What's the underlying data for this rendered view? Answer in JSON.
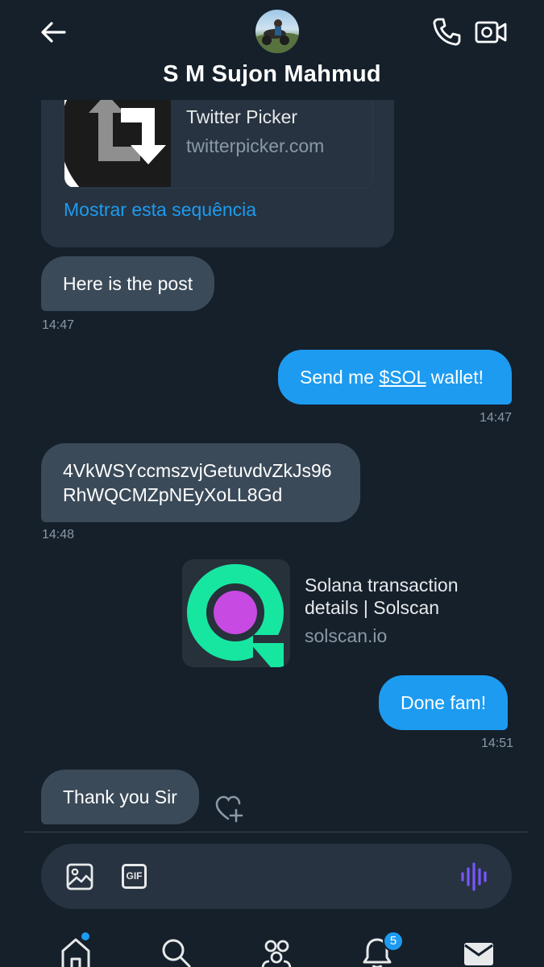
{
  "header": {
    "contact_name": "S M Sujon Mahmud",
    "back_icon": "arrow-left-icon",
    "call_icon": "phone-icon",
    "video_icon": "video-camera-icon"
  },
  "messages": [
    {
      "type": "link_card",
      "direction": "incoming",
      "card_title": "Twitter Picker",
      "card_domain": "twitterpicker.com",
      "action_link": "Mostrar esta sequência"
    },
    {
      "type": "text",
      "direction": "incoming",
      "text": "Here is the post",
      "time": "14:47"
    },
    {
      "type": "text",
      "direction": "outgoing",
      "text_before": "Send me ",
      "cashtag": "$SOL",
      "text_after": " wallet!",
      "time": "14:47"
    },
    {
      "type": "text",
      "direction": "incoming",
      "line1": "4VkWSYccmszvjGetuvdvZkJs96",
      "line2": "RhWQCMZpNEyXoLL8Gd",
      "time": "14:48"
    },
    {
      "type": "link_card",
      "direction": "outgoing",
      "card_title": "Solana transaction details | Solscan",
      "card_domain": "solscan.io"
    },
    {
      "type": "text",
      "direction": "outgoing",
      "text": "Done fam!",
      "time": "14:51"
    },
    {
      "type": "text",
      "direction": "incoming",
      "text": "Thank you Sir"
    }
  ],
  "composer": {
    "image_icon": "image-icon",
    "gif_label": "GIF",
    "voice_icon": "voice-waveform-icon"
  },
  "tabbar": {
    "notifications_count": "5"
  },
  "colors": {
    "background": "#15202b",
    "incoming_bubble": "#3b4a59",
    "outgoing_bubble": "#1d9bf0",
    "link": "#1d9bf0",
    "timestamp": "#8b98a5",
    "solscan_accent": "#17e6a1",
    "solscan_center": "#c74ae3",
    "voice_accent": "#7856ff"
  }
}
